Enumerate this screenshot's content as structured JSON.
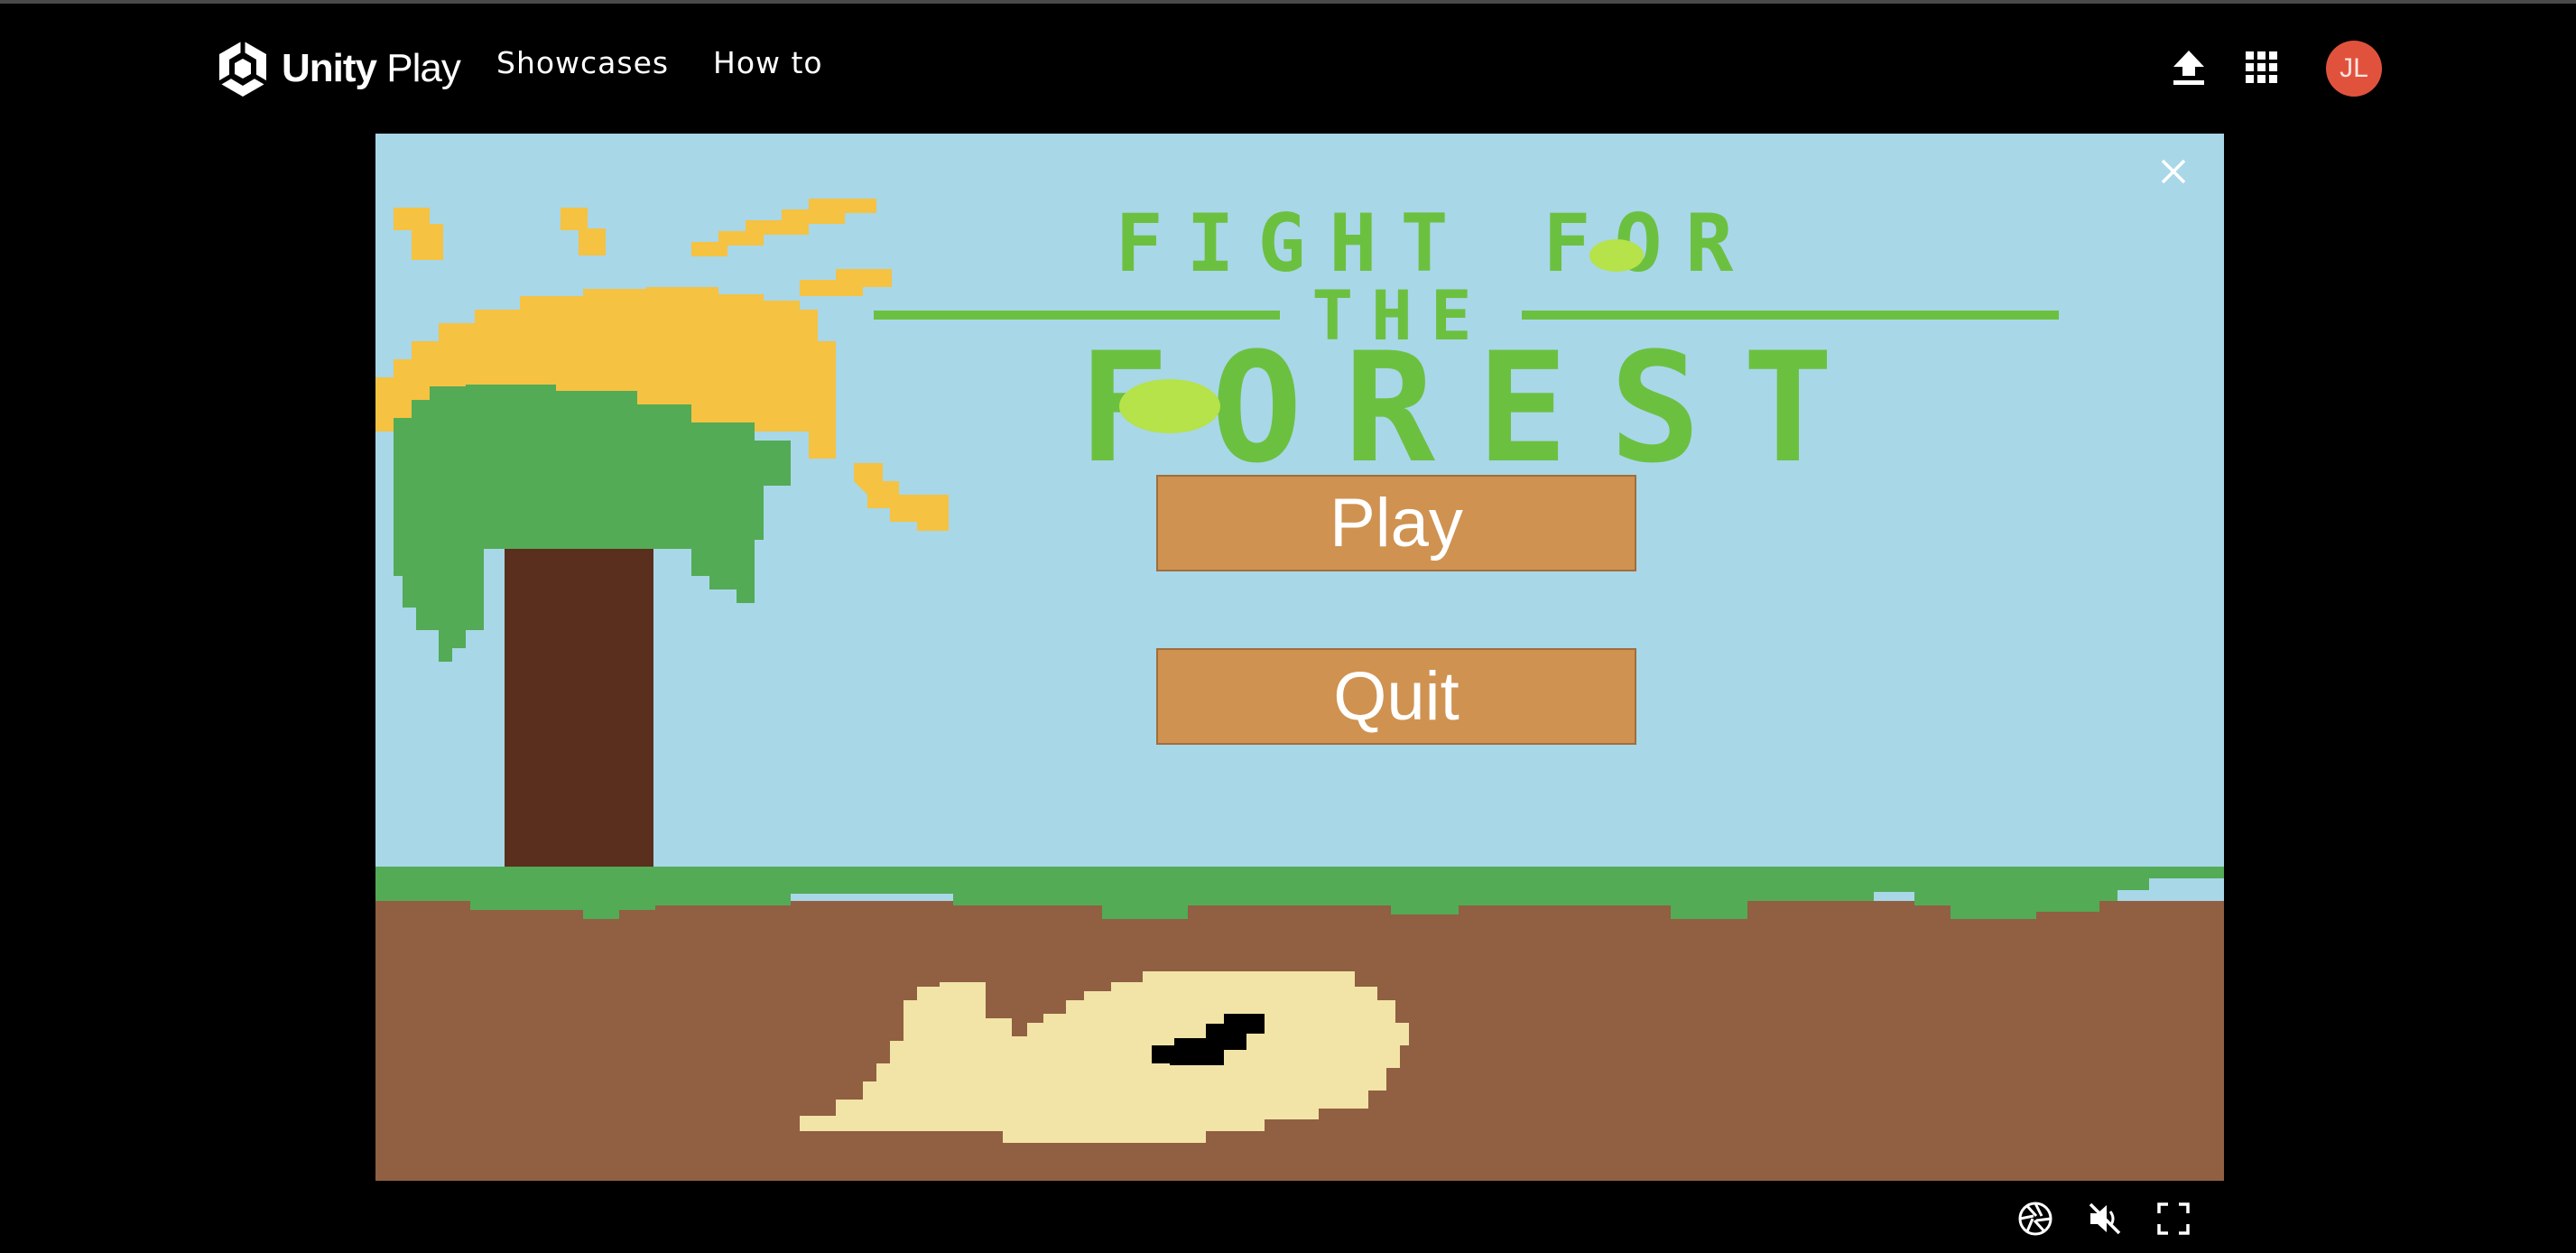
{
  "header": {
    "brand_bold": "Unity",
    "brand_light": " Play",
    "nav": [
      {
        "label": "Showcases"
      },
      {
        "label": "How to"
      }
    ],
    "icons": [
      "upload-icon",
      "apps-grid-icon"
    ],
    "avatar_initials": "JL",
    "avatar_color": "#e1523d"
  },
  "game": {
    "title_line1": "FIGHT FOR",
    "title_line2": "THE",
    "title_line3": "FOREST",
    "buttons": {
      "play": "Play",
      "quit": "Quit"
    },
    "close_icon": "close-icon",
    "colors": {
      "sky": "#a8d7e8",
      "title_green": "#6cc040",
      "title_accent": "#b6e24a",
      "grass": "#53ab55",
      "dirt": "#915f42",
      "sun": "#f5c242",
      "trunk": "#5a2f1e",
      "leaves": "#53ab55",
      "button": "#cf9251",
      "bone": "#f2e4a6"
    }
  },
  "controls": {
    "icons": [
      "camera-aperture-icon",
      "mute-icon",
      "fullscreen-icon"
    ]
  }
}
